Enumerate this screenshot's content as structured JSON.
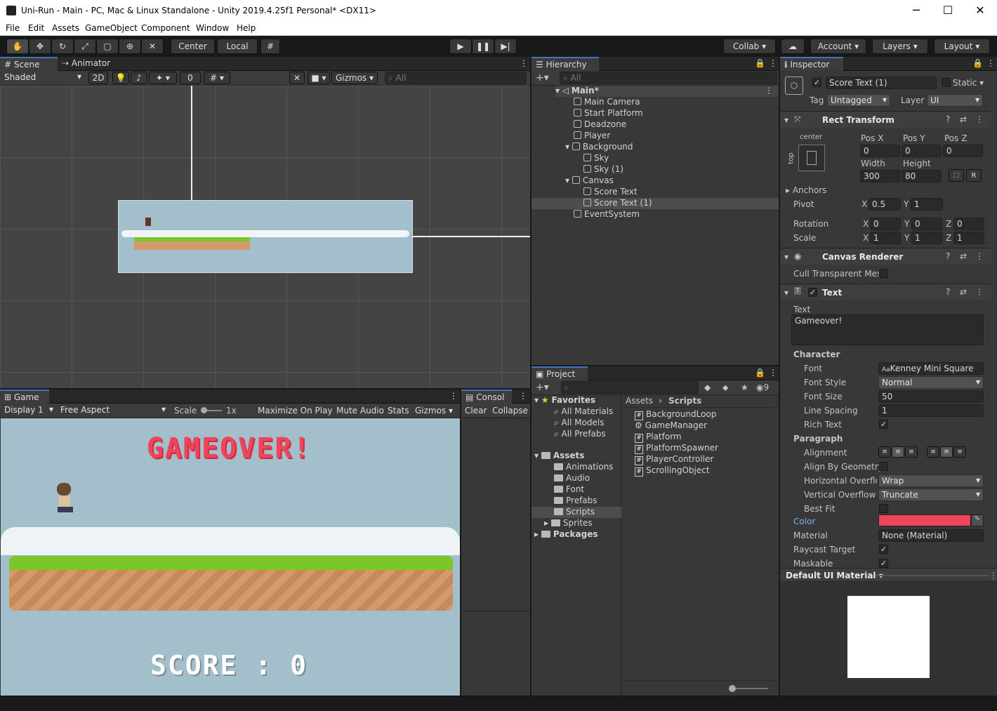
{
  "window": {
    "title": "Uni-Run - Main - PC, Mac & Linux Standalone - Unity 2019.4.25f1 Personal* <DX11>",
    "minimize": "─",
    "maximize": "☐",
    "close": "✕"
  },
  "menu": [
    "File",
    "Edit",
    "Assets",
    "GameObject",
    "Component",
    "Window",
    "Help"
  ],
  "toolbar": {
    "pivot": "Center",
    "space": "Local",
    "collab": "Collab ▾",
    "account": "Account",
    "layers": "Layers",
    "layout": "Layout"
  },
  "scene": {
    "tab": "Scene",
    "tab2": "Animator",
    "shading": "Shaded",
    "mode2d": "2D",
    "hidden_count": "0",
    "gizmos": "Gizmos",
    "search": "All"
  },
  "game": {
    "tab": "Game",
    "display": "Display 1",
    "aspect": "Free Aspect",
    "scale_label": "Scale",
    "scale_value": "1x",
    "maximize": "Maximize On Play",
    "mute": "Mute Audio",
    "stats": "Stats",
    "gizmos": "Gizmos",
    "gameover": "GAMEOVER!",
    "score": "SCORE : 0"
  },
  "console": {
    "tab": "Consol",
    "clear": "Clear",
    "collapse": "Collapse"
  },
  "hierarchy": {
    "tab": "Hierarchy",
    "search": "All",
    "items": [
      {
        "label": "Main*",
        "depth": 0
      },
      {
        "label": "Main Camera",
        "depth": 1
      },
      {
        "label": "Start Platform",
        "depth": 1
      },
      {
        "label": "Deadzone",
        "depth": 1
      },
      {
        "label": "Player",
        "depth": 1
      },
      {
        "label": "Background",
        "depth": 1
      },
      {
        "label": "Sky",
        "depth": 2
      },
      {
        "label": "Sky (1)",
        "depth": 2
      },
      {
        "label": "Canvas",
        "depth": 1
      },
      {
        "label": "Score Text",
        "depth": 2
      },
      {
        "label": "Score Text (1)",
        "depth": 2
      },
      {
        "label": "EventSystem",
        "depth": 1
      }
    ]
  },
  "project": {
    "tab": "Project",
    "count": "9",
    "favorites": "Favorites",
    "fav_items": [
      "All Materials",
      "All Models",
      "All Prefabs"
    ],
    "assets": "Assets",
    "folders": [
      "Animations",
      "Audio",
      "Font",
      "Prefabs",
      "Scripts",
      "Sprites"
    ],
    "packages": "Packages",
    "breadcrumb": [
      "Assets",
      "Scripts"
    ],
    "files": [
      "BackgroundLoop",
      "GameManager",
      "Platform",
      "PlatformSpawner",
      "PlayerController",
      "ScrollingObject"
    ]
  },
  "inspector": {
    "tab": "Inspector",
    "name": "Score Text (1)",
    "static": "Static",
    "tag_label": "Tag",
    "tag": "Untagged",
    "layer_label": "Layer",
    "layer": "UI",
    "rect": {
      "title": "Rect Transform",
      "anchor_h": "center",
      "anchor_v": "top",
      "posx_l": "Pos X",
      "posy_l": "Pos Y",
      "posz_l": "Pos Z",
      "posx": "0",
      "posy": "0",
      "posz": "0",
      "w_l": "Width",
      "h_l": "Height",
      "w": "300",
      "h": "80",
      "r": "R",
      "anchors": "Anchors",
      "pivot": "Pivot",
      "pivot_x": "0.5",
      "pivot_y": "1",
      "rotation": "Rotation",
      "rx": "0",
      "ry": "0",
      "rz": "0",
      "scale": "Scale",
      "sx": "1",
      "sy": "1",
      "sz": "1",
      "x": "X",
      "y": "Y",
      "z": "Z"
    },
    "renderer": {
      "title": "Canvas Renderer",
      "cull": "Cull Transparent Mes"
    },
    "text": {
      "title": "Text",
      "text_l": "Text",
      "text": "Gameover!",
      "character": "Character",
      "font_l": "Font",
      "font": "Kenney Mini Square",
      "style_l": "Font Style",
      "style": "Normal",
      "size_l": "Font Size",
      "size": "50",
      "spacing_l": "Line Spacing",
      "spacing": "1",
      "rich_l": "Rich Text",
      "paragraph": "Paragraph",
      "align_l": "Alignment",
      "geom_l": "Align By Geometry",
      "hover_l": "Horizontal Overflo",
      "hover": "Wrap",
      "vover_l": "Vertical Overflow",
      "vover": "Truncate",
      "bestfit_l": "Best Fit",
      "color_l": "Color",
      "color": "#f0445a",
      "material_l": "Material",
      "material": "None (Material)",
      "raycast_l": "Raycast Target",
      "maskable_l": "Maskable"
    },
    "material": "Default UI Material"
  },
  "colors": {
    "accent": "#3a79bb",
    "sky": "#a4bfcc",
    "grass": "#7cc62a",
    "dirt": "#d49a6a",
    "title_red": "#f0445a"
  }
}
